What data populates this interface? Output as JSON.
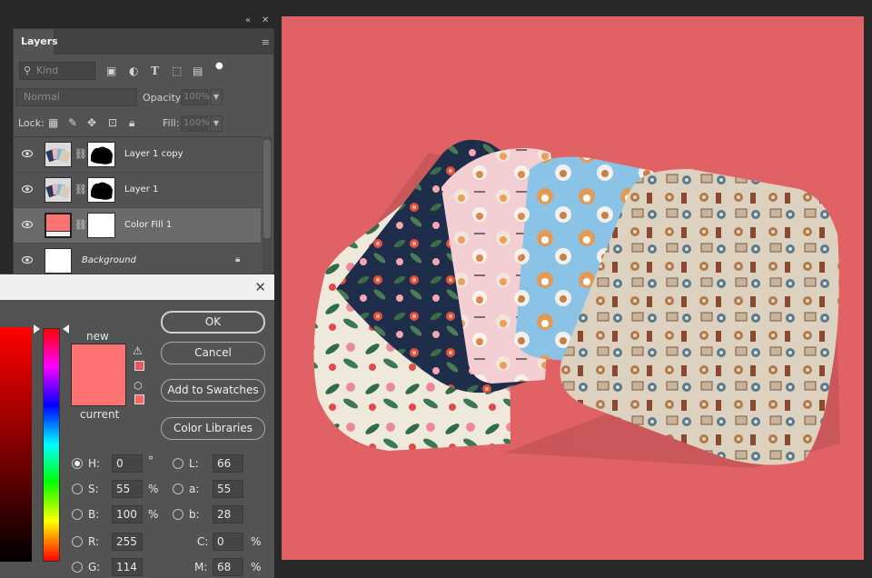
{
  "panel_strip": {
    "collapse_icon": "«",
    "close_icon": "✕"
  },
  "layers_panel": {
    "tab_label": "Layers",
    "menu_icon": "≡",
    "filter": {
      "placeholder": "Kind",
      "search_icon": "⚲"
    },
    "blend_mode": "Normal",
    "opacity_label": "Opacity:",
    "opacity_value": "100%",
    "lock_label": "Lock:",
    "fill_label": "Fill:",
    "fill_value": "100%",
    "layers": [
      {
        "name": "Layer 1 copy",
        "visible": true,
        "has_mask": true
      },
      {
        "name": "Layer 1",
        "visible": true,
        "has_mask": true
      },
      {
        "name": "Color Fill 1",
        "visible": true,
        "has_mask": true,
        "selected": true,
        "fill_color": "#ff7272"
      },
      {
        "name": "Background",
        "visible": true,
        "locked": true
      }
    ]
  },
  "color_picker": {
    "close_icon": "✕",
    "new_label": "new",
    "current_label": "current",
    "new_color": "#ff7272",
    "current_color": "#ff7272",
    "buttons": {
      "ok": "OK",
      "cancel": "Cancel",
      "add_swatches": "Add to Swatches",
      "color_libraries": "Color Libraries"
    },
    "gamut_warning_icon": "⚠",
    "web_safe_icon": "⬡",
    "fields": {
      "H": {
        "label": "H:",
        "value": "0",
        "unit": "°"
      },
      "S": {
        "label": "S:",
        "value": "55",
        "unit": "%"
      },
      "B": {
        "label": "B:",
        "value": "100",
        "unit": "%"
      },
      "R": {
        "label": "R:",
        "value": "255"
      },
      "G": {
        "label": "G:",
        "value": "114"
      },
      "L": {
        "label": "L:",
        "value": "66"
      },
      "a": {
        "label": "a:",
        "value": "55"
      },
      "b": {
        "label": "b:",
        "value": "28"
      },
      "C": {
        "label": "C:",
        "value": "0",
        "unit": "%"
      },
      "M": {
        "label": "M:",
        "value": "68",
        "unit": "%"
      }
    }
  },
  "canvas": {
    "background_color": "#e16264"
  }
}
